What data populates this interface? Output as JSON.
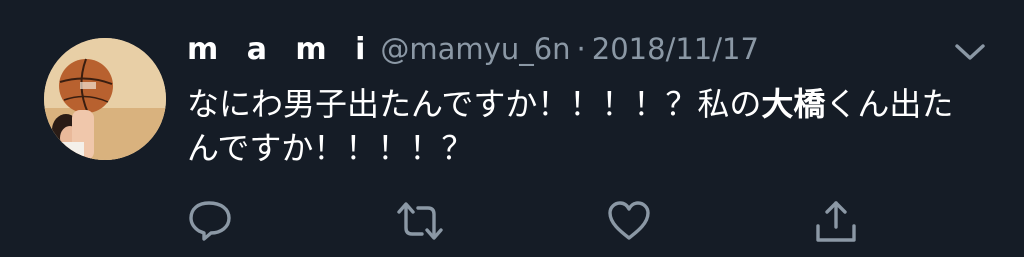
{
  "tweet": {
    "display_name": "m a m i",
    "handle": "@mamyu_6n",
    "separator": "·",
    "date": "2018/11/17",
    "text_part1": "なにわ男子出たんですか！！！！？私の",
    "text_bold": "大橋",
    "text_part2": "くん出たんですか！！！！？"
  },
  "icons": {
    "more": "chevron-down-icon",
    "reply": "reply-icon",
    "retweet": "retweet-icon",
    "like": "heart-icon",
    "share": "share-icon"
  },
  "colors": {
    "background": "#151c26",
    "text": "#ffffff",
    "secondary": "#8b98a5"
  }
}
